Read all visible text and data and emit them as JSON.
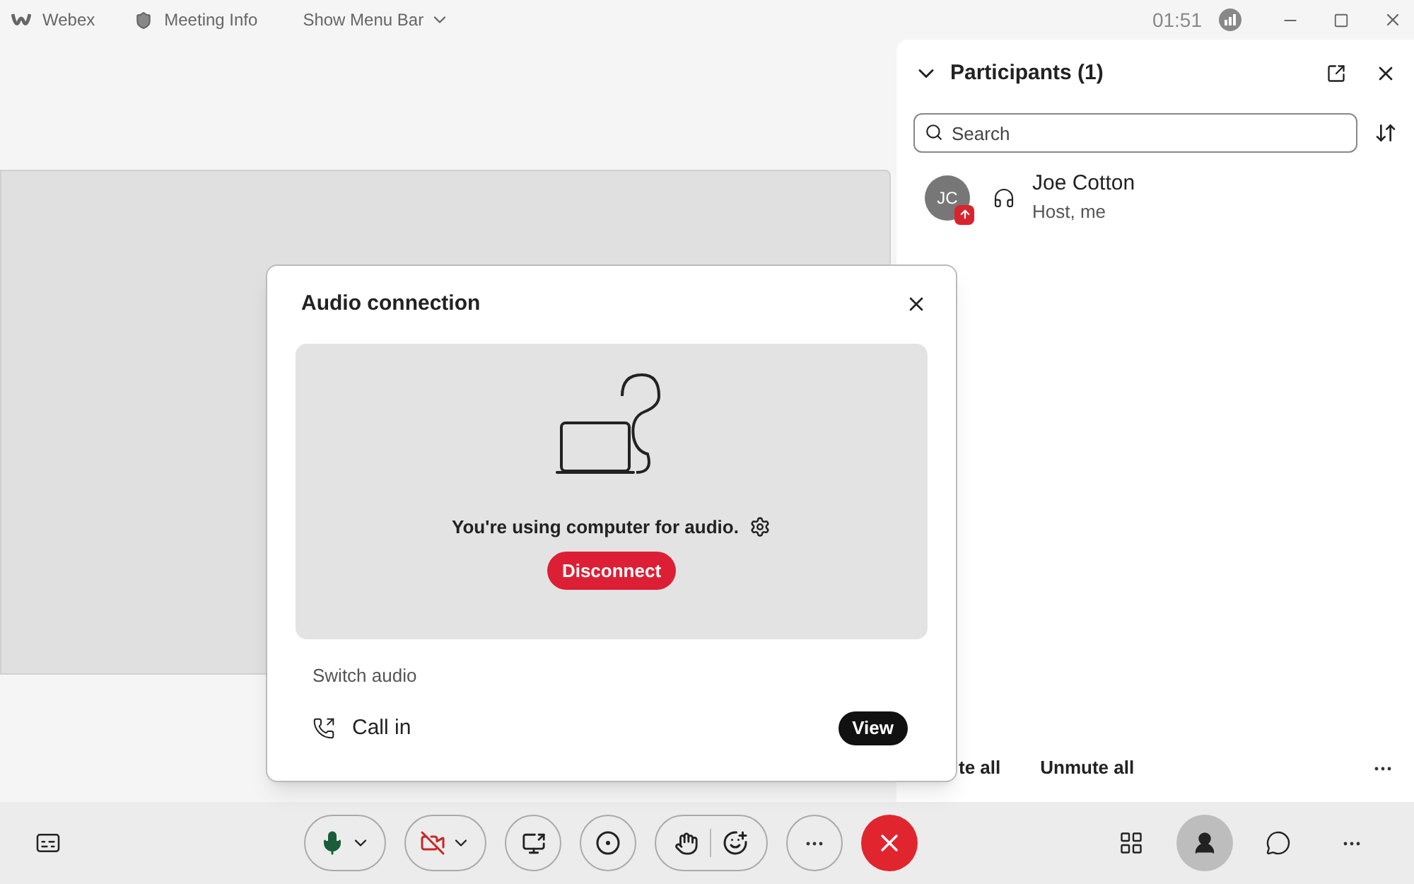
{
  "title_bar": {
    "app_name": "Webex",
    "meeting_info": "Meeting Info",
    "menu_toggle": "Show Menu Bar",
    "time": "01:51"
  },
  "participants_panel": {
    "title": "Participants (1)",
    "search": {
      "placeholder": "Search"
    },
    "participants": [
      {
        "initials": "JC",
        "name": "Joe Cotton",
        "role": "Host, me"
      }
    ],
    "footer_buttons": [
      "te all",
      "Unmute all"
    ]
  },
  "audio_dialog": {
    "title": "Audio connection",
    "status": "You're using computer for audio.",
    "disconnect": "Disconnect",
    "section": "Switch audio",
    "options": [
      {
        "label": "Call in",
        "action": "View"
      }
    ]
  },
  "toolbar": {
    "right": [
      {
        "kind": "apps",
        "selected": false
      },
      {
        "kind": "participants",
        "selected": true
      },
      {
        "kind": "chat",
        "selected": false
      },
      {
        "kind": "more",
        "selected": false
      }
    ]
  }
}
